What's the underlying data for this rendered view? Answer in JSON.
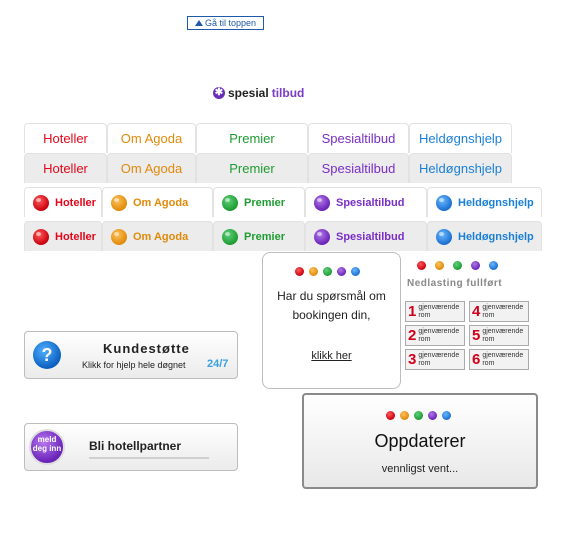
{
  "back_to_top": {
    "label": "Gå til toppen"
  },
  "special": {
    "word1": "spesial",
    "word2": "tilbud"
  },
  "tabs_text": [
    {
      "label": "Hoteller",
      "color": "#e2071b"
    },
    {
      "label": "Om Agoda",
      "color": "#e08a0a"
    },
    {
      "label": "Premier",
      "color": "#1e9b32"
    },
    {
      "label": "Spesialtilbud",
      "color": "#7a2ec4"
    },
    {
      "label": "Heldøgnshjelp",
      "color": "#1a7fd8"
    }
  ],
  "tabs_icons": [
    {
      "label": "Hoteller",
      "icon": "red-ball-icon"
    },
    {
      "label": "Om Agoda",
      "icon": "orange-ball-icon"
    },
    {
      "label": "Premier",
      "icon": "green-ball-icon"
    },
    {
      "label": "Spesialtilbud",
      "icon": "purple-ball-icon"
    },
    {
      "label": "Heldøgnshjelp",
      "icon": "blue-ball-icon"
    }
  ],
  "support": {
    "icon_glyph": "?",
    "title": "Kundestøtte",
    "subtitle": "Klikk for hjelp hele døgnet",
    "hours": "24/7"
  },
  "partner": {
    "icon_text": "meld deg inn",
    "label": "Bli hotellpartner"
  },
  "question": {
    "text": "Har du spørsmål om bookingen din,",
    "link": "klikk her"
  },
  "download": {
    "status": "Nedlasting fullført"
  },
  "rooms": [
    {
      "num": "1",
      "label": "gjenværende rom"
    },
    {
      "num": "4",
      "label": "gjenværende rom"
    },
    {
      "num": "2",
      "label": "gjenværende rom"
    },
    {
      "num": "5",
      "label": "gjenværende rom"
    },
    {
      "num": "3",
      "label": "gjenværende rom"
    },
    {
      "num": "6",
      "label": "gjenværende rom"
    }
  ],
  "updating": {
    "title": "Oppdaterer",
    "subtitle": "vennligst vent..."
  }
}
